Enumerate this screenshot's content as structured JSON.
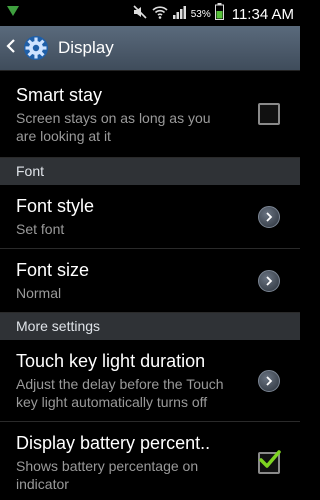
{
  "status_bar": {
    "battery_percent": "53%",
    "time": "11:34 AM"
  },
  "action_bar": {
    "title": "Display"
  },
  "settings": {
    "smart_stay": {
      "title": "Smart stay",
      "summary": "Screen stays on as long as you are looking at it",
      "checked": false
    },
    "font_category": "Font",
    "font_style": {
      "title": "Font style",
      "summary": "Set font"
    },
    "font_size": {
      "title": "Font size",
      "summary": "Normal"
    },
    "more_category": "More settings",
    "touch_key": {
      "title": "Touch key light duration",
      "summary": "Adjust the delay before the Touch key light automatically turns off"
    },
    "battery_percent": {
      "title": "Display battery percent..",
      "summary": "Shows battery percentage on indicator",
      "checked": true
    }
  },
  "colors": {
    "action_bar": "#4a5868",
    "category_bg": "#2f3236",
    "check_green": "#7ed321"
  }
}
